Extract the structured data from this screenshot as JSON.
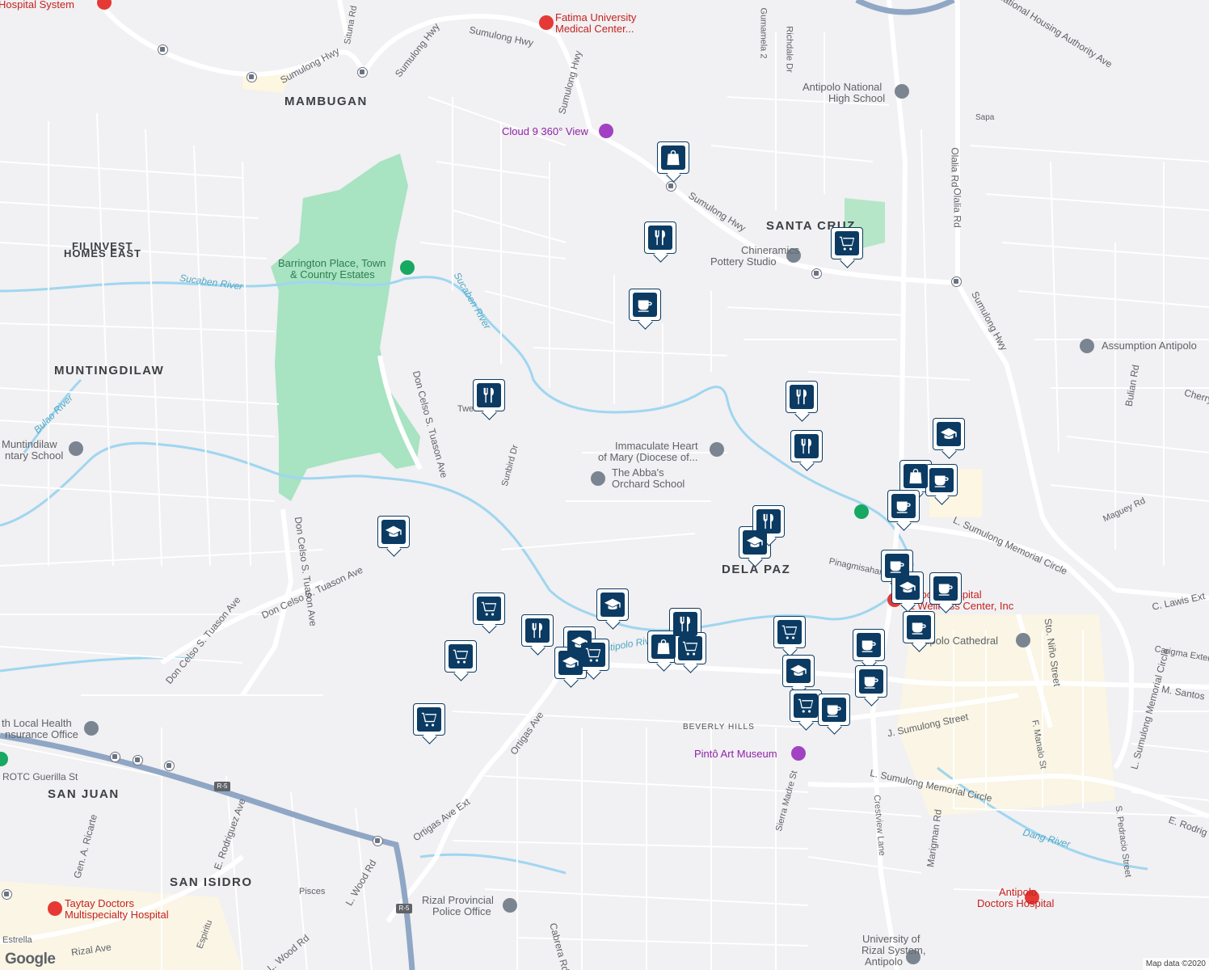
{
  "areas": {
    "mambugan": "MAMBUGAN",
    "filinvest_1": "FILINVEST",
    "filinvest_2": "HOMES EAST",
    "muntingdilaw": "MUNTINGDILAW",
    "santa_cruz": "SANTA CRUZ",
    "dela_paz": "DELA PAZ",
    "beverly_hills": "BEVERLY HILLS",
    "san_juan": "SAN JUAN",
    "san_isidro": "SAN ISIDRO"
  },
  "places": {
    "hospital_system": "Hospital System",
    "fatima_1": "Fatima University",
    "fatima_2": "Medical Center...",
    "cloud9": "Cloud 9 360° View",
    "antipolo_nhs_1": "Antipolo National",
    "antipolo_nhs_2": "High School",
    "chineramics_1": "Chineramics",
    "chineramics_2": "Pottery Studio",
    "barrington_1": "Barrington Place, Town",
    "barrington_2": "& Country Estates",
    "assumption": "Assumption Antipolo",
    "muntindilaw_school_1": "Muntindilaw",
    "muntindilaw_school_2": "ntary School",
    "immaculate_1": "Immaculate Heart",
    "immaculate_2": "of Mary (Diocese of...",
    "abba_1": "The Abba's",
    "abba_2": "Orchard School",
    "antipolo_hosp_1": "nicipolo Hospital",
    "antipolo_hosp_2": "& Wellness Center, Inc",
    "cathedral": "Antipolo Cathedral",
    "pinto": "Pintô Art Museum",
    "health_1": "th Local Health",
    "health_2": "nsurance Office",
    "rotc": "ROTC Guerilla St",
    "taytay_1": "Taytay Doctors",
    "taytay_2": "Multispecialty Hospital",
    "rizal_police_1": "Rizal Provincial",
    "rizal_police_2": "Police Office",
    "antipolo_doctors_1": "Antipolo",
    "antipolo_doctors_2": "Doctors Hospital",
    "urs_1": "University of",
    "urs_2": "Rizal System,",
    "urs_3": "Antipolo"
  },
  "roads": {
    "sumulong_hwy": "Sumulong Hwy",
    "situna": "Situna Rd",
    "gumamela": "Gumamela 2",
    "richdale": "Richdale Dr",
    "nha_ave": "National Housing Authority Ave",
    "olalia": "Olalia Rd",
    "sapa": "Sapa",
    "bulian": "Bulian Rd",
    "cherry": "Cherry",
    "tuason": "Don Celso S. Tuason Ave",
    "tweety": "Tweety",
    "sunbird": "Sunbird Dr",
    "maguey": "Maguey Rd",
    "l_sumulong_circle": "L. Sumulong Memorial Circle",
    "pinagmisahan": "Pinagmisahan St",
    "c_lewis": "C. Lawis Ext",
    "sto_nino": "Sto. Niño Street",
    "carigma": "Carigma Extension",
    "m_santos": "M. Santos",
    "j_sumulong": "J. Sumulong Street",
    "f_manalo": "F. Manalo St",
    "crestview": "Crestview Lane",
    "marigman": "Marigman Rd",
    "sierra_madre": "Sierra Madre St",
    "ortigas": "Ortigas Ave",
    "ortigas_ext": "Ortigas Ave Ext",
    "cabrera": "Cabrera Rd",
    "l_wood": "L. Wood Rd",
    "pisces": "Pisces",
    "e_rodriguez": "E. Rodriguez Ave",
    "e_rodrig": "E. Rodrig",
    "gen_ricarte": "Gen. A. Ricarte",
    "rizal_ave": "Rizal Ave",
    "estrella": "Estrella",
    "espiritu": "Espiritu",
    "s_pedracio": "S. Pedracio Street",
    "r5": "R-5"
  },
  "water": {
    "sucaben_1": "Sucaben River",
    "sucaben_2": "Sucaben River",
    "bulao": "Bulao River",
    "antipolo_river": "Antipolo River",
    "dang": "Dang River"
  },
  "markers": [
    {
      "type": "shopping-bag"
    },
    {
      "type": "restaurant"
    },
    {
      "type": "cafe"
    },
    {
      "type": "grocery"
    },
    {
      "type": "restaurant"
    },
    {
      "type": "restaurant"
    },
    {
      "type": "restaurant"
    },
    {
      "type": "school"
    },
    {
      "type": "shopping-bag"
    },
    {
      "type": "cafe"
    },
    {
      "type": "cafe"
    },
    {
      "type": "school"
    },
    {
      "type": "school"
    },
    {
      "type": "restaurant"
    },
    {
      "type": "cafe"
    },
    {
      "type": "school"
    },
    {
      "type": "cafe"
    },
    {
      "type": "grocery"
    },
    {
      "type": "restaurant"
    },
    {
      "type": "school"
    },
    {
      "type": "grocery"
    },
    {
      "type": "school"
    },
    {
      "type": "school"
    },
    {
      "type": "grocery"
    },
    {
      "type": "grocery"
    },
    {
      "type": "restaurant"
    },
    {
      "type": "shopping-bag"
    },
    {
      "type": "grocery"
    },
    {
      "type": "grocery"
    },
    {
      "type": "school"
    },
    {
      "type": "cafe"
    },
    {
      "type": "cafe"
    },
    {
      "type": "grocery"
    },
    {
      "type": "cafe"
    },
    {
      "type": "cafe"
    }
  ],
  "google": "Google",
  "attribution": "Map data ©2020"
}
